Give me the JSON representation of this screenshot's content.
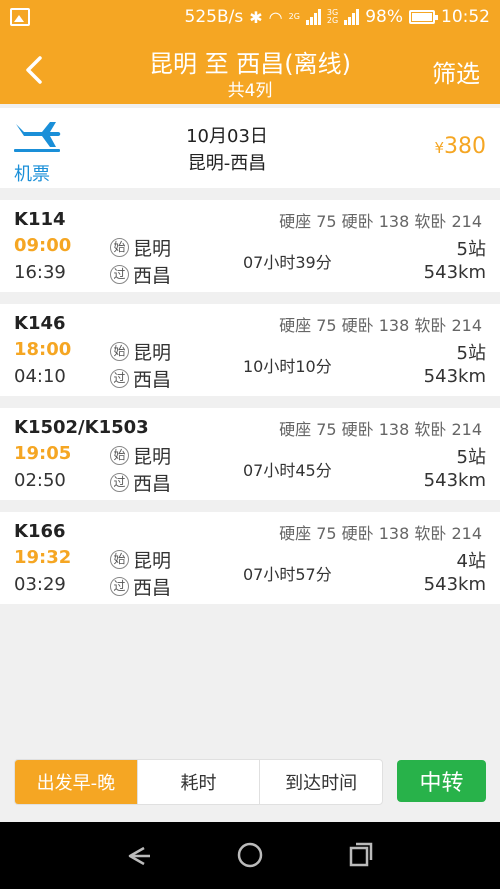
{
  "status_bar": {
    "speed": "525B/s",
    "battery": "98%",
    "time": "10:52",
    "net_top": "2G",
    "net_bottom_1": "3G",
    "net_bottom_2": "2G"
  },
  "header": {
    "title": "昆明 至 西昌(离线)",
    "subtitle": "共4列",
    "filter_label": "筛选"
  },
  "ticket": {
    "label": "机票",
    "date": "10月03日",
    "route": "昆明-西昌",
    "currency": "¥",
    "price": "380"
  },
  "trains": [
    {
      "number": "K114",
      "seats": "硬座 75 硬卧 138 软卧 214",
      "depart": "09:00",
      "arrive": "16:39",
      "from_badge": "始",
      "from": "昆明",
      "to_badge": "过",
      "to": "西昌",
      "duration": "07小时39分",
      "stops": "5站",
      "distance": "543km"
    },
    {
      "number": "K146",
      "seats": "硬座 75 硬卧 138 软卧 214",
      "depart": "18:00",
      "arrive": "04:10",
      "from_badge": "始",
      "from": "昆明",
      "to_badge": "过",
      "to": "西昌",
      "duration": "10小时10分",
      "stops": "5站",
      "distance": "543km"
    },
    {
      "number": "K1502/K1503",
      "seats": "硬座 75 硬卧 138 软卧 214",
      "depart": "19:05",
      "arrive": "02:50",
      "from_badge": "始",
      "from": "昆明",
      "to_badge": "过",
      "to": "西昌",
      "duration": "07小时45分",
      "stops": "5站",
      "distance": "543km"
    },
    {
      "number": "K166",
      "seats": "硬座 75 硬卧 138 软卧 214",
      "depart": "19:32",
      "arrive": "03:29",
      "from_badge": "始",
      "from": "昆明",
      "to_badge": "过",
      "to": "西昌",
      "duration": "07小时57分",
      "stops": "4站",
      "distance": "543km"
    }
  ],
  "sort": {
    "tabs": [
      "出发早-晚",
      "耗时",
      "到达时间"
    ],
    "active_index": 0
  },
  "transfer_label": "中转",
  "colors": {
    "accent": "#f5a623",
    "transfer": "#28b24a",
    "flight": "#1a8fd8"
  },
  "icons": {
    "back": "chevron-left-icon",
    "plane": "airplane-icon",
    "nav_back": "triangle-back-icon",
    "nav_home": "circle-home-icon",
    "nav_recent": "square-recent-icon"
  }
}
